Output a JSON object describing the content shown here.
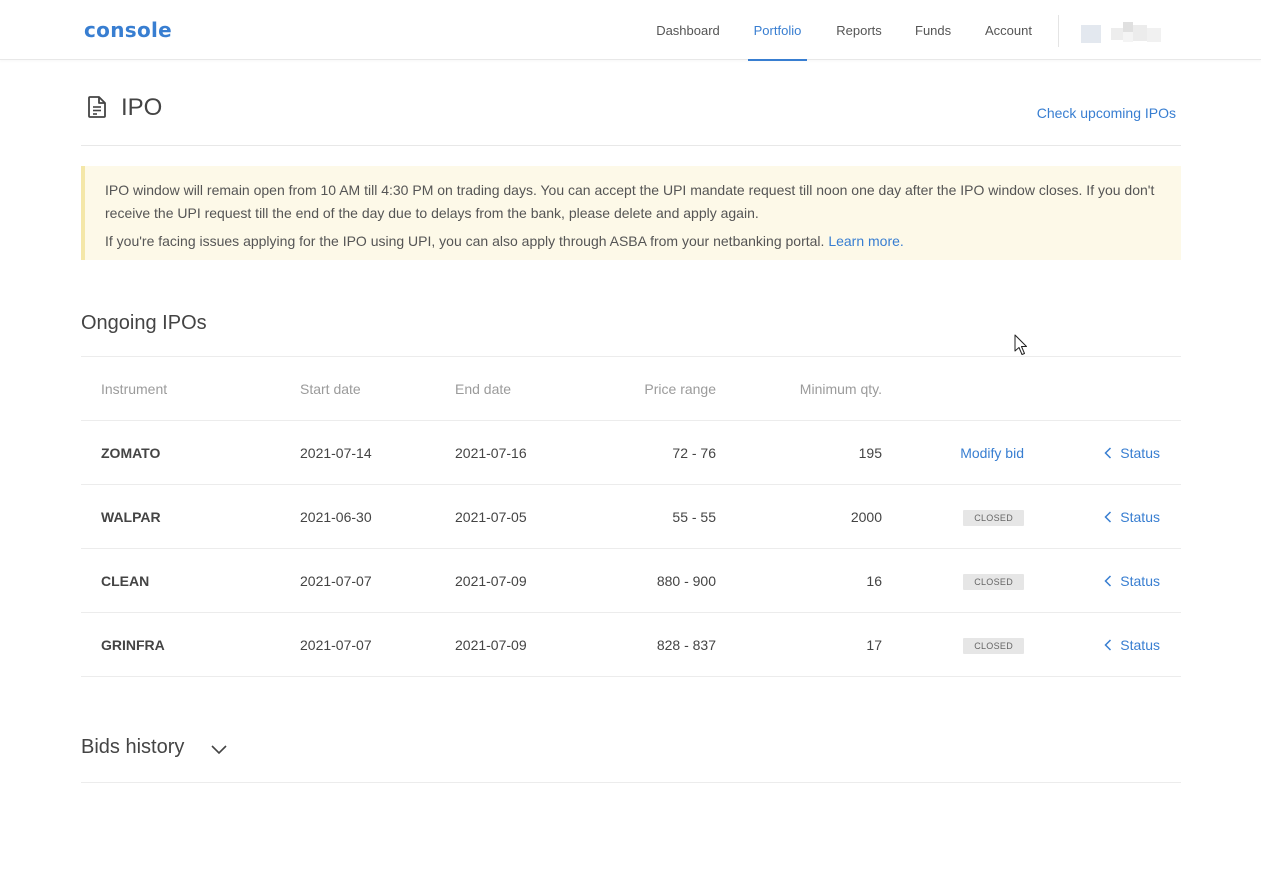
{
  "header": {
    "logo": "console",
    "nav": [
      {
        "label": "Dashboard",
        "active": false
      },
      {
        "label": "Portfolio",
        "active": true
      },
      {
        "label": "Reports",
        "active": false
      },
      {
        "label": "Funds",
        "active": false
      },
      {
        "label": "Account",
        "active": false
      }
    ],
    "accent_color": "#387ed1"
  },
  "page": {
    "title": "IPO",
    "title_icon": "document-icon",
    "upcoming_link": "Check upcoming IPOs"
  },
  "notice": {
    "line1": "IPO window will remain open from 10 AM till 4:30 PM on trading days. You can accept the UPI mandate request till noon one day after the IPO window closes. If you don't receive the UPI request till the end of the day due to delays from the bank, please delete and apply again.",
    "line2": "If you're facing issues applying for the IPO using UPI, you can also apply through ASBA from your netbanking portal.",
    "learn_more": "Learn more."
  },
  "ongoing": {
    "title": "Ongoing IPOs",
    "columns": {
      "instrument": "Instrument",
      "start_date": "Start date",
      "end_date": "End date",
      "price_range": "Price range",
      "min_qty": "Minimum qty."
    },
    "rows": [
      {
        "instrument": "ZOMATO",
        "start_date": "2021-07-14",
        "end_date": "2021-07-16",
        "price_range": "72 - 76",
        "min_qty": "195",
        "action": "Modify bid",
        "status": "Status"
      },
      {
        "instrument": "WALPAR",
        "start_date": "2021-06-30",
        "end_date": "2021-07-05",
        "price_range": "55 - 55",
        "min_qty": "2000",
        "action": "CLOSED",
        "status": "Status"
      },
      {
        "instrument": "CLEAN",
        "start_date": "2021-07-07",
        "end_date": "2021-07-09",
        "price_range": "880 - 900",
        "min_qty": "16",
        "action": "CLOSED",
        "status": "Status"
      },
      {
        "instrument": "GRINFRA",
        "start_date": "2021-07-07",
        "end_date": "2021-07-09",
        "price_range": "828 - 837",
        "min_qty": "17",
        "action": "CLOSED",
        "status": "Status"
      }
    ]
  },
  "bids_history": {
    "title": "Bids history",
    "icon": "chevron-down-icon"
  }
}
